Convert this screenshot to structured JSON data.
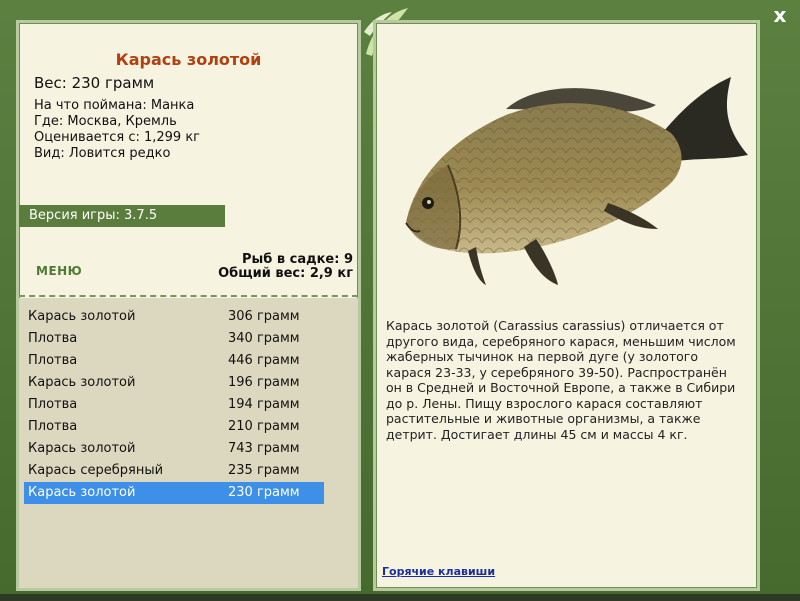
{
  "window": {
    "close_label": "x"
  },
  "fish": {
    "title": "Карась золотой",
    "weight": "Вес: 230 грамм",
    "caught_on": "На что поймана: Манка",
    "location": "Где: Москва, Кремль",
    "rating": "Оценивается с: 1,299 кг",
    "kind": "Вид: Ловится редко"
  },
  "version": "Версия игры: 3.7.5",
  "menu_label": "МЕНЮ",
  "stats": {
    "fish_in_net": "Рыб в садке: 9",
    "total_weight": "Общий вес: 2,9 кг"
  },
  "catch_list": [
    {
      "name": "Карась золотой",
      "weight": "306 грамм"
    },
    {
      "name": "Плотва",
      "weight": "340 грамм"
    },
    {
      "name": "Плотва",
      "weight": "446 грамм"
    },
    {
      "name": "Карась золотой",
      "weight": "196 грамм"
    },
    {
      "name": "Плотва",
      "weight": "194 грамм"
    },
    {
      "name": "Плотва",
      "weight": "210 грамм"
    },
    {
      "name": "Карась золотой",
      "weight": "743 грамм"
    },
    {
      "name": "Карась серебряный",
      "weight": "235 грамм"
    },
    {
      "name": "Карась золотой",
      "weight": "230 грамм"
    }
  ],
  "selected_index": 8,
  "description": "Карась золотой (Carassius carassius) отличается от другого вида, серебряного карася, меньшим числом жаберных тычинок на первой дуге (у золотого карася 23-33, у серебряного 39-50). Распространён он в Средней и Восточной Европе, а также в Сибири до р. Лены. Пищу взрослого карася составляют растительные и животные организмы, а также детрит. Достигает длины 45 см и массы 4 кг.",
  "hotkeys_label": "Горячие клавиши",
  "colors": {
    "title": "#b0400f",
    "frame_green": "#4e6e34",
    "selected_row": "#3d8fe8",
    "link": "#1a2f9c"
  }
}
